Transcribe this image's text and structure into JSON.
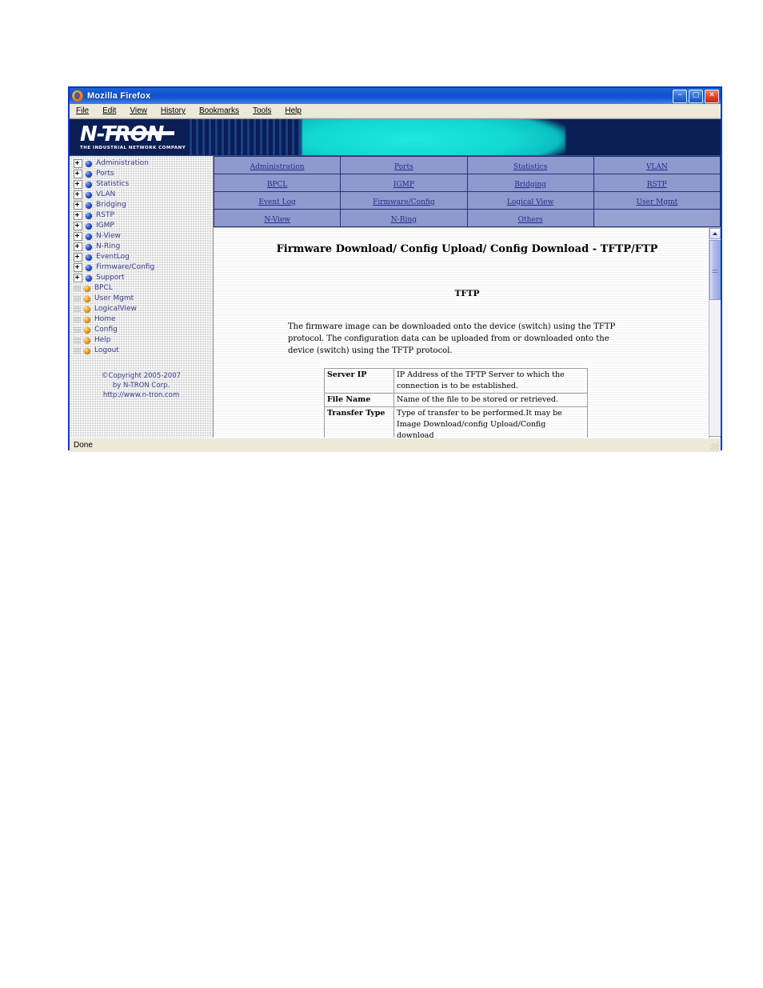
{
  "window": {
    "title": "Mozilla Firefox",
    "icon": "firefox-icon",
    "minimize_glyph": "–",
    "maximize_glyph": "□",
    "close_glyph": "✕"
  },
  "menubar": {
    "items": [
      {
        "label": "File"
      },
      {
        "label": "Edit"
      },
      {
        "label": "View"
      },
      {
        "label": "History"
      },
      {
        "label": "Bookmarks"
      },
      {
        "label": "Tools"
      },
      {
        "label": "Help"
      }
    ]
  },
  "banner": {
    "logo_word": "N-TRON",
    "logo_tagline": "THE INDUSTRIAL NETWORK COMPANY",
    "bg_color": "#0b1f54",
    "accent_color": "#12d8d0"
  },
  "sidebar": {
    "nodes": [
      {
        "label": "Administration",
        "type": "branch"
      },
      {
        "label": "Ports",
        "type": "branch"
      },
      {
        "label": "Statistics",
        "type": "branch"
      },
      {
        "label": "VLAN",
        "type": "branch"
      },
      {
        "label": "Bridging",
        "type": "branch"
      },
      {
        "label": "RSTP",
        "type": "branch"
      },
      {
        "label": "IGMP",
        "type": "branch"
      },
      {
        "label": "N-View",
        "type": "branch"
      },
      {
        "label": "N-Ring",
        "type": "branch"
      },
      {
        "label": "EventLog",
        "type": "branch"
      },
      {
        "label": "Firmware/Config",
        "type": "branch"
      },
      {
        "label": "Support",
        "type": "branch"
      },
      {
        "label": "BPCL",
        "type": "leaf"
      },
      {
        "label": "User Mgmt",
        "type": "leaf"
      },
      {
        "label": "LogicalView",
        "type": "leaf"
      },
      {
        "label": "Home",
        "type": "leaf"
      },
      {
        "label": "Config",
        "type": "leaf"
      },
      {
        "label": "Help",
        "type": "leaf"
      },
      {
        "label": "Logout",
        "type": "leaf"
      }
    ],
    "copyright": {
      "line1": "©Copyright 2005-2007",
      "line2": "by N-TRON Corp.",
      "line3": "http://www.n-tron.com"
    }
  },
  "navtable": {
    "rows": [
      [
        {
          "label": "Administration",
          "link": true
        },
        {
          "label": "Ports",
          "link": true
        },
        {
          "label": "Statistics",
          "link": true
        },
        {
          "label": "VLAN",
          "link": true
        }
      ],
      [
        {
          "label": "BPCL",
          "link": true
        },
        {
          "label": "IGMP",
          "link": true
        },
        {
          "label": "Bridging",
          "link": true
        },
        {
          "label": "RSTP",
          "link": true
        }
      ],
      [
        {
          "label": "Event Log",
          "link": true
        },
        {
          "label": "Firmware/Config",
          "link": true
        },
        {
          "label": "Logical View",
          "link": true
        },
        {
          "label": "User Mgmt",
          "link": true
        }
      ],
      [
        {
          "label": "N-View",
          "link": true
        },
        {
          "label": "N-Ring",
          "link": true
        },
        {
          "label": "Others",
          "link": true
        },
        {
          "label": "",
          "link": false
        }
      ]
    ]
  },
  "document": {
    "heading": "Firmware Download/ Config Upload/ Config Download - TFTP/FTP",
    "subheading": "TFTP",
    "paragraph": "The firmware image can be downloaded onto the device (switch) using the TFTP protocol. The configuration data can be uploaded from or downloaded onto the device (switch) using the TFTP protocol.",
    "fields": [
      {
        "name": "Server IP",
        "description": "IP Address of the TFTP Server to which the connection is to be established."
      },
      {
        "name": "File Name",
        "description": "Name of the file to be stored or retrieved."
      },
      {
        "name": "Transfer Type",
        "description": "Type of transfer to be performed.It may be Image Download/config Upload/Config download"
      }
    ]
  },
  "statusbar": {
    "text": "Done"
  }
}
